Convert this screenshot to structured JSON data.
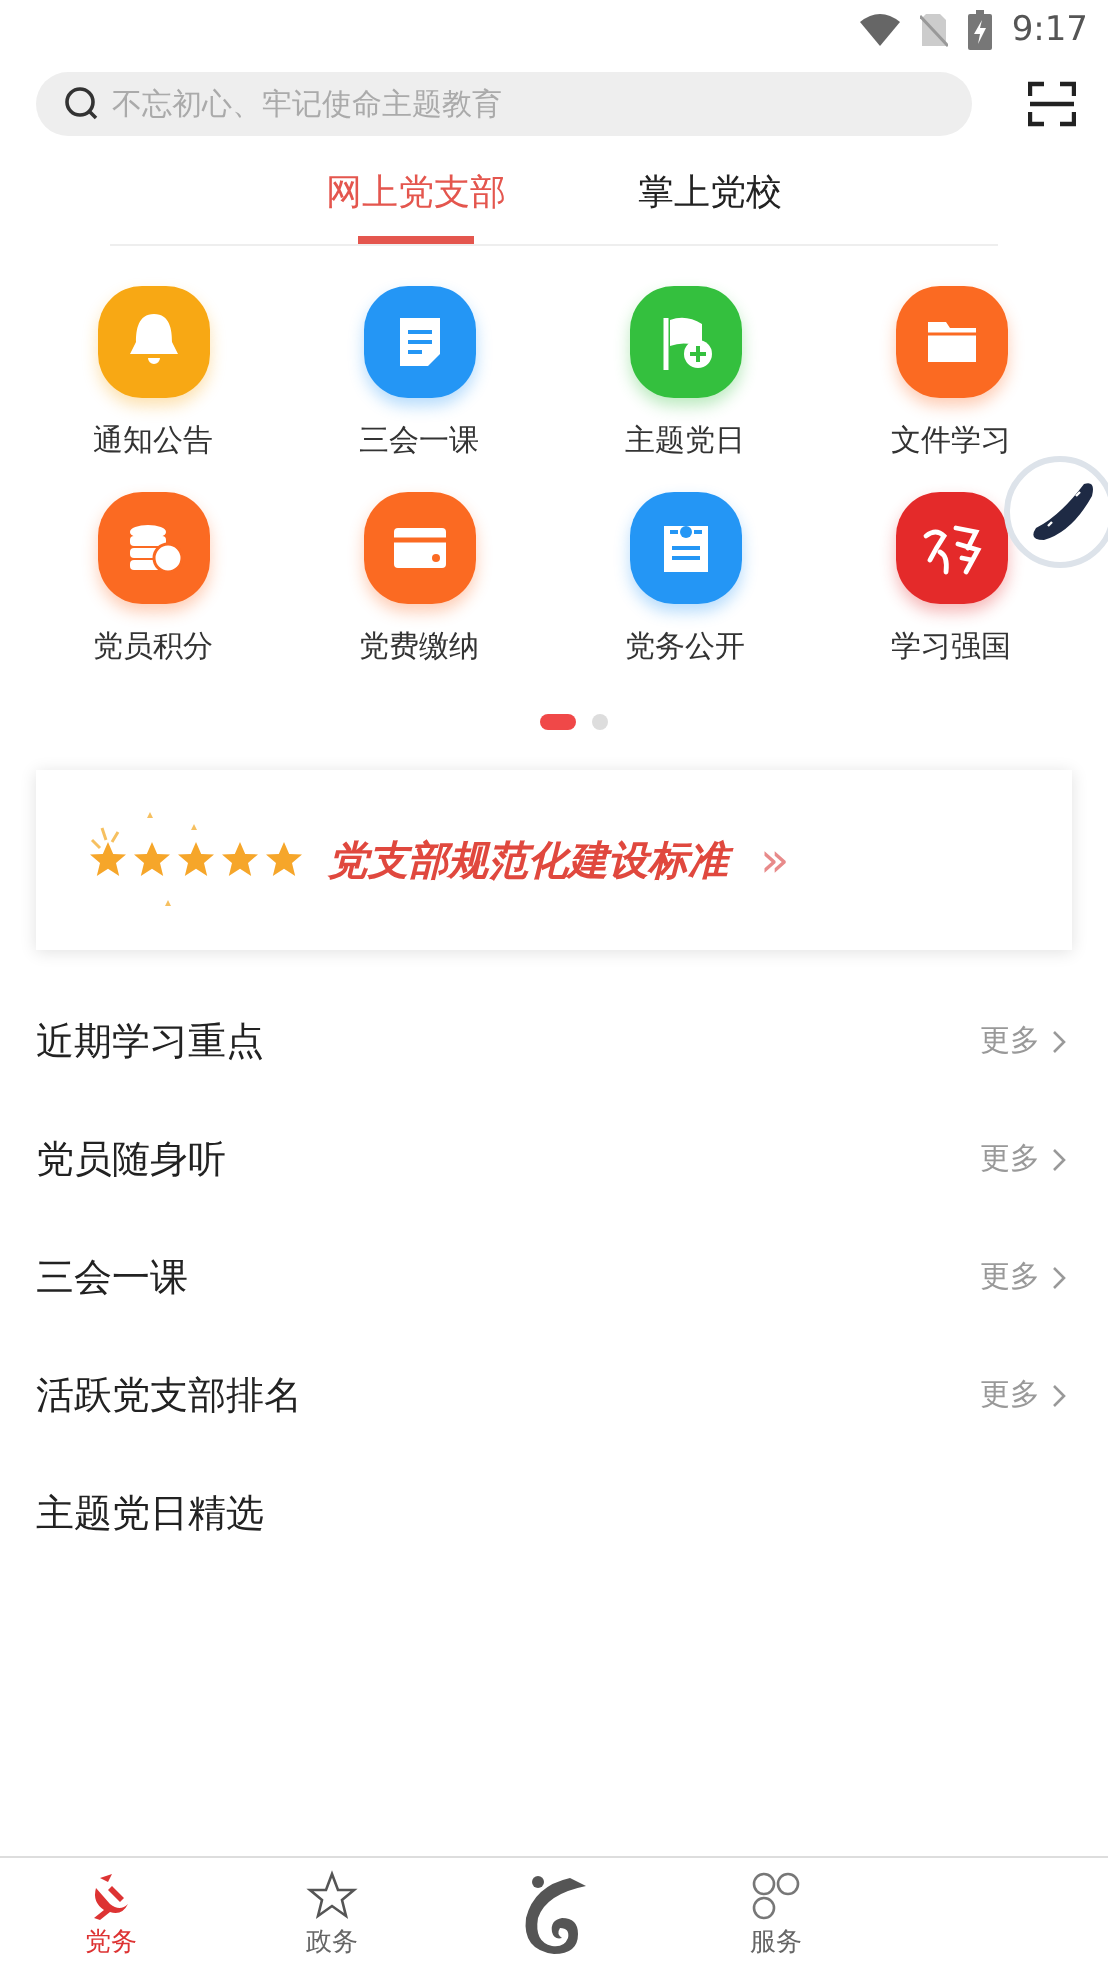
{
  "status_bar": {
    "time": "9:17"
  },
  "search": {
    "placeholder": "不忘初心、牢记使命主题教育"
  },
  "tabs": [
    {
      "label": "网上党支部",
      "selected": true
    },
    {
      "label": "掌上党校",
      "selected": false
    }
  ],
  "grid": [
    {
      "label": "通知公告",
      "kind": "bell",
      "color": "#f8a814"
    },
    {
      "label": "三会一课",
      "kind": "document",
      "color": "#2496f5"
    },
    {
      "label": "主题党日",
      "kind": "flag",
      "color": "#34c03e"
    },
    {
      "label": "文件学习",
      "kind": "folder",
      "color": "#fb6a22"
    },
    {
      "label": "党员积分",
      "kind": "coins",
      "color": "#fb6a22"
    },
    {
      "label": "党费缴纳",
      "kind": "card",
      "color": "#fb6a22"
    },
    {
      "label": "党务公开",
      "kind": "notice",
      "color": "#2496f5"
    },
    {
      "label": "学习强国",
      "kind": "brush",
      "color": "#e42a2a"
    }
  ],
  "pager": [
    {
      "selected": true
    },
    {
      "selected": false
    }
  ],
  "banner": {
    "title": "党支部规范化建设标准",
    "arrow": "»"
  },
  "sections": [
    {
      "title": "近期学习重点",
      "more": "更多"
    },
    {
      "title": "党员随身听",
      "more": "更多"
    },
    {
      "title": "三会一课",
      "more": "更多"
    },
    {
      "title": "活跃党支部排名",
      "more": "更多"
    },
    {
      "title": "主题党日精选"
    }
  ],
  "bottom_nav": [
    {
      "kind": "emblem",
      "label": "党务",
      "selected": true
    },
    {
      "kind": "star",
      "label": "政务",
      "selected": false
    },
    {
      "kind": "logo"
    },
    {
      "kind": "circles",
      "label": "服务",
      "selected": false
    }
  ]
}
